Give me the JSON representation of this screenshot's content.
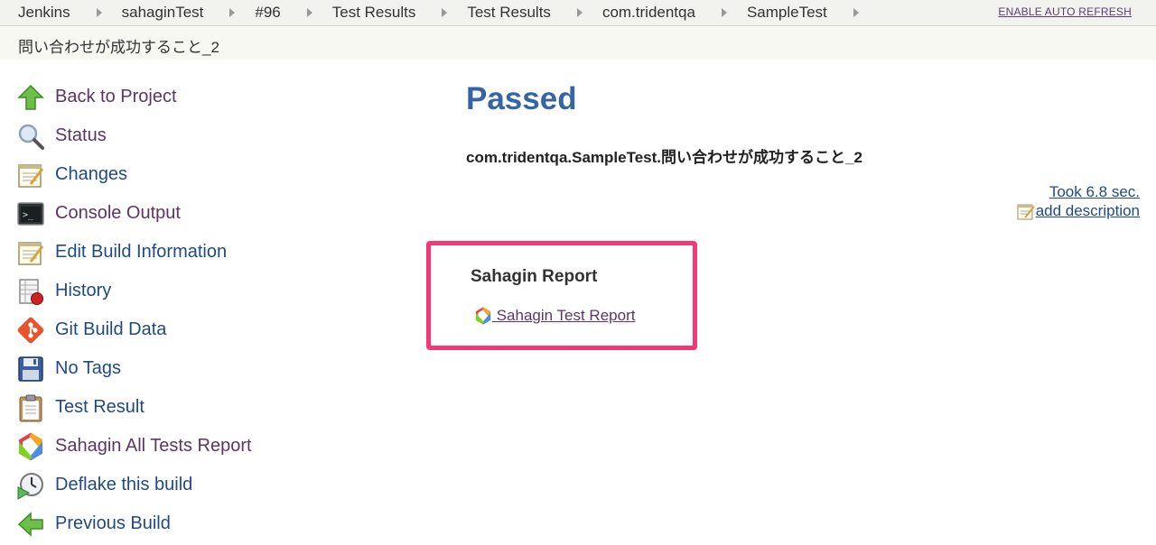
{
  "breadcrumbs": [
    {
      "label": "Jenkins"
    },
    {
      "label": "sahaginTest"
    },
    {
      "label": "#96"
    },
    {
      "label": "Test Results"
    },
    {
      "label": "Test Results"
    },
    {
      "label": "com.tridentqa"
    },
    {
      "label": "SampleTest"
    }
  ],
  "header": {
    "auto_refresh": "ENABLE AUTO REFRESH",
    "subtitle": "問い合わせが成功すること_2"
  },
  "sidebar": {
    "items": [
      {
        "label": "Back to Project",
        "icon": "up-arrow-icon"
      },
      {
        "label": "Status",
        "icon": "magnifier-icon"
      },
      {
        "label": "Changes",
        "icon": "notepad-icon"
      },
      {
        "label": "Console Output",
        "icon": "terminal-icon"
      },
      {
        "label": "Edit Build Information",
        "icon": "notepad-icon"
      },
      {
        "label": "History",
        "icon": "history-icon"
      },
      {
        "label": "Git Build Data",
        "icon": "git-icon"
      },
      {
        "label": "No Tags",
        "icon": "save-icon"
      },
      {
        "label": "Test Result",
        "icon": "clipboard-icon"
      },
      {
        "label": "Sahagin All Tests Report",
        "icon": "sahagin-icon"
      },
      {
        "label": "Deflake this build",
        "icon": "deflake-icon"
      },
      {
        "label": "Previous Build",
        "icon": "left-arrow-icon"
      }
    ]
  },
  "main": {
    "status": "Passed",
    "test_name": "com.tridentqa.SampleTest.問い合わせが成功すること_2",
    "took": "Took 6.8 sec.",
    "add_description": "add description",
    "sahagin": {
      "heading": "Sahagin Report",
      "link": " Sahagin Test Report"
    }
  },
  "colors": {
    "status_title": "#3465a4",
    "highlight_border": "#f53677",
    "link": "#204a87",
    "visited_link": "#5c3566"
  }
}
